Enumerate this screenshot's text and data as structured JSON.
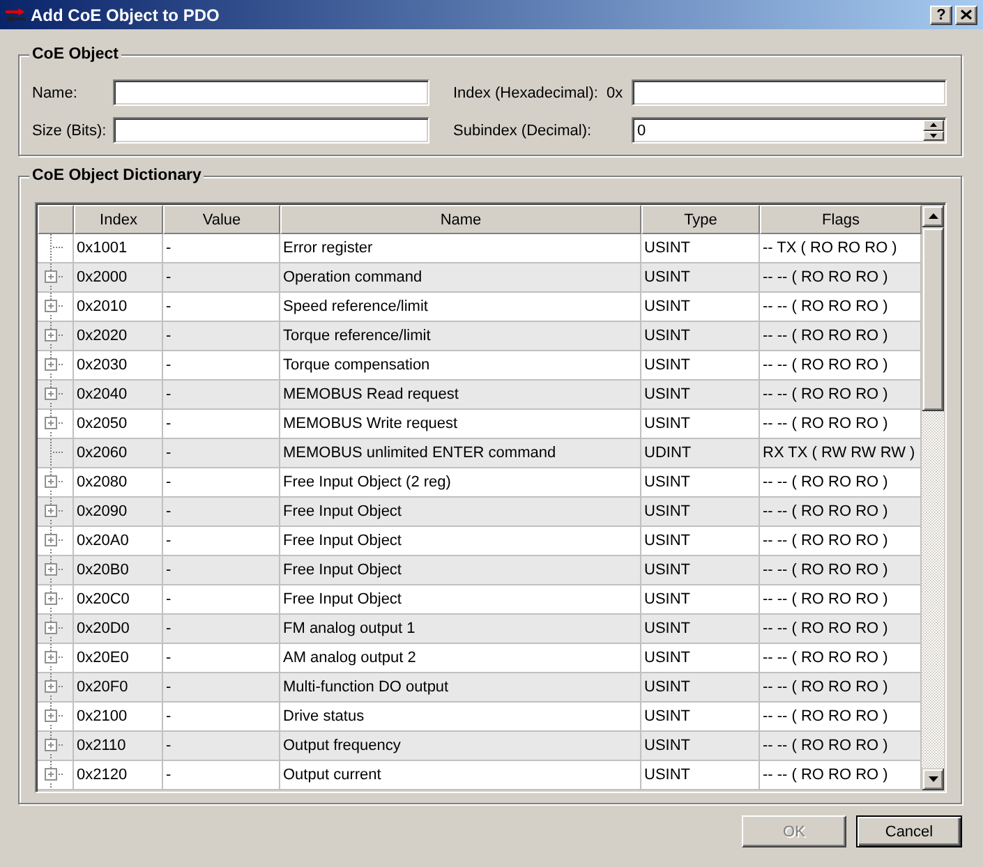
{
  "window": {
    "title": "Add CoE Object to PDO",
    "help_button": "?"
  },
  "coe_object": {
    "legend": "CoE Object",
    "name_field": {
      "label": "Name:"
    },
    "index_field": {
      "label": "Index (Hexadecimal):",
      "prefix": "0x"
    },
    "size_field": {
      "label": "Size (Bits):"
    },
    "subindex_field": {
      "label": "Subindex (Decimal):",
      "value": "0"
    }
  },
  "dictionary": {
    "legend": "CoE Object Dictionary",
    "columns": [
      "Index",
      "Value",
      "Name",
      "Type",
      "Flags"
    ],
    "rows": [
      {
        "index": "0x1001",
        "value": "-",
        "name": "Error register",
        "type": "USINT",
        "flags": "-- TX ( RO RO RO )",
        "expandable": false,
        "selected": false
      },
      {
        "index": "0x2000",
        "value": "-",
        "name": "Operation command",
        "type": "USINT",
        "flags": "-- -- ( RO RO RO )",
        "expandable": true,
        "selected": false
      },
      {
        "index": "0x2010",
        "value": "-",
        "name": "Speed reference/limit",
        "type": "USINT",
        "flags": "-- -- ( RO RO RO )",
        "expandable": true,
        "selected": false
      },
      {
        "index": "0x2020",
        "value": "-",
        "name": "Torque reference/limit",
        "type": "USINT",
        "flags": "-- -- ( RO RO RO )",
        "expandable": true,
        "selected": false
      },
      {
        "index": "0x2030",
        "value": "-",
        "name": "Torque compensation",
        "type": "USINT",
        "flags": "-- -- ( RO RO RO )",
        "expandable": true,
        "selected": false
      },
      {
        "index": "0x2040",
        "value": "-",
        "name": "MEMOBUS Read request",
        "type": "USINT",
        "flags": "-- -- ( RO RO RO )",
        "expandable": true,
        "selected": false
      },
      {
        "index": "0x2050",
        "value": "-",
        "name": "MEMOBUS Write request",
        "type": "USINT",
        "flags": "-- -- ( RO RO RO )",
        "expandable": true,
        "selected": false
      },
      {
        "index": "0x2060",
        "value": "-",
        "name": "MEMOBUS unlimited ENTER command",
        "type": "UDINT",
        "flags": "RX TX ( RW RW RW )",
        "expandable": false,
        "selected": false
      },
      {
        "index": "0x2080",
        "value": "-",
        "name": "Free Input Object (2 reg)",
        "type": "USINT",
        "flags": "-- -- ( RO RO RO )",
        "expandable": true,
        "selected": false
      },
      {
        "index": "0x2090",
        "value": "-",
        "name": "Free Input Object",
        "type": "USINT",
        "flags": "-- -- ( RO RO RO )",
        "expandable": true,
        "selected": false
      },
      {
        "index": "0x20A0",
        "value": "-",
        "name": "Free Input Object",
        "type": "USINT",
        "flags": "-- -- ( RO RO RO )",
        "expandable": true,
        "selected": false
      },
      {
        "index": "0x20B0",
        "value": "-",
        "name": "Free Input Object",
        "type": "USINT",
        "flags": "-- -- ( RO RO RO )",
        "expandable": true,
        "selected": false
      },
      {
        "index": "0x20C0",
        "value": "-",
        "name": "Free Input Object",
        "type": "USINT",
        "flags": "-- -- ( RO RO RO )",
        "expandable": true,
        "selected": false
      },
      {
        "index": "0x20D0",
        "value": "-",
        "name": "FM analog output 1",
        "type": "USINT",
        "flags": "-- -- ( RO RO RO )",
        "expandable": true,
        "selected": false
      },
      {
        "index": "0x20E0",
        "value": "-",
        "name": "AM analog output 2",
        "type": "USINT",
        "flags": "-- -- ( RO RO RO )",
        "expandable": true,
        "selected": false
      },
      {
        "index": "0x20F0",
        "value": "-",
        "name": "Multi-function DO output",
        "type": "USINT",
        "flags": "-- -- ( RO RO RO )",
        "expandable": true,
        "selected": false
      },
      {
        "index": "0x2100",
        "value": "-",
        "name": "Drive status",
        "type": "USINT",
        "flags": "-- -- ( RO RO RO )",
        "expandable": true,
        "selected": false
      },
      {
        "index": "0x2110",
        "value": "-",
        "name": "Output frequency",
        "type": "USINT",
        "flags": "-- -- ( RO RO RO )",
        "expandable": true,
        "selected": false
      },
      {
        "index": "0x2120",
        "value": "-",
        "name": "Output current",
        "type": "USINT",
        "flags": "-- -- ( RO RO RO )",
        "expandable": true,
        "selected": false
      }
    ]
  },
  "buttons": [
    {
      "label": "OK",
      "disabled": true,
      "default": false
    },
    {
      "label": "Cancel",
      "disabled": false,
      "default": true
    }
  ]
}
